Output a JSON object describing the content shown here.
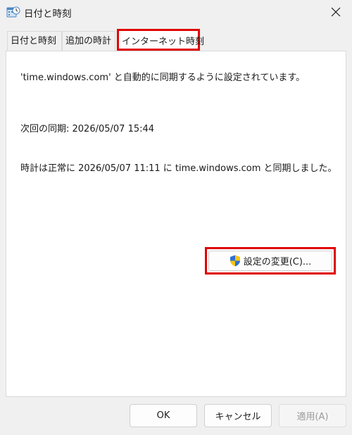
{
  "window": {
    "title": "日付と時刻",
    "app_icon": "datetime-app-icon",
    "close_icon": "close-icon"
  },
  "tabs": [
    {
      "label": "日付と時刻",
      "selected": false
    },
    {
      "label": "追加の時計",
      "selected": false
    },
    {
      "label": "インターネット時刻",
      "selected": true
    }
  ],
  "panel": {
    "sync_status": "'time.windows.com' と自動的に同期するように設定されています。",
    "next_sync": "次回の同期: 2026/05/07 15:44",
    "last_sync": "時計は正常に 2026/05/07 11:11 に time.windows.com と同期しました。",
    "change_settings_label": "設定の変更(C)...",
    "shield_icon": "uac-shield-icon"
  },
  "footer": {
    "ok_label": "OK",
    "cancel_label": "キャンセル",
    "apply_label": "適用(A)"
  },
  "colors": {
    "highlight": "#e00000",
    "window_bg": "#f0f0f0",
    "panel_bg": "#ffffff"
  }
}
